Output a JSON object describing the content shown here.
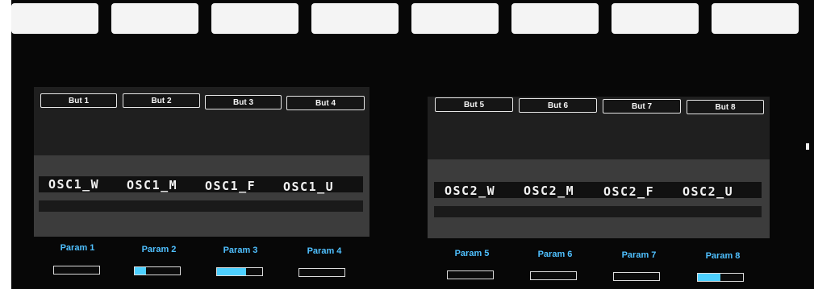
{
  "hardware_buttons": [
    "",
    "",
    "",
    "",
    "",
    "",
    "",
    ""
  ],
  "left_screen": {
    "buttons": [
      "But 1",
      "But 2",
      "But 3",
      "But 4"
    ],
    "osc_labels": [
      "OSC1_W",
      "OSC1_M",
      "OSC1_F",
      "OSC1_U"
    ],
    "params": [
      {
        "label": "Param 1",
        "value": 0.0
      },
      {
        "label": "Param 2",
        "value": 0.25
      },
      {
        "label": "Param 3",
        "value": 0.65
      },
      {
        "label": "Param 4",
        "value": 0.0
      }
    ]
  },
  "right_screen": {
    "buttons": [
      "But 5",
      "But 6",
      "But 7",
      "But 8"
    ],
    "osc_labels": [
      "OSC2_W",
      "OSC2_M",
      "OSC2_F",
      "OSC2_U"
    ],
    "params": [
      {
        "label": "Param 5",
        "value": 0.0
      },
      {
        "label": "Param 6",
        "value": 0.0
      },
      {
        "label": "Param 7",
        "value": 0.0
      },
      {
        "label": "Param 8",
        "value": 0.5
      }
    ]
  },
  "colors": {
    "param_text": "#4fc0ff",
    "param_fill": "#4dd0ff",
    "screen_bg": "#262626"
  }
}
